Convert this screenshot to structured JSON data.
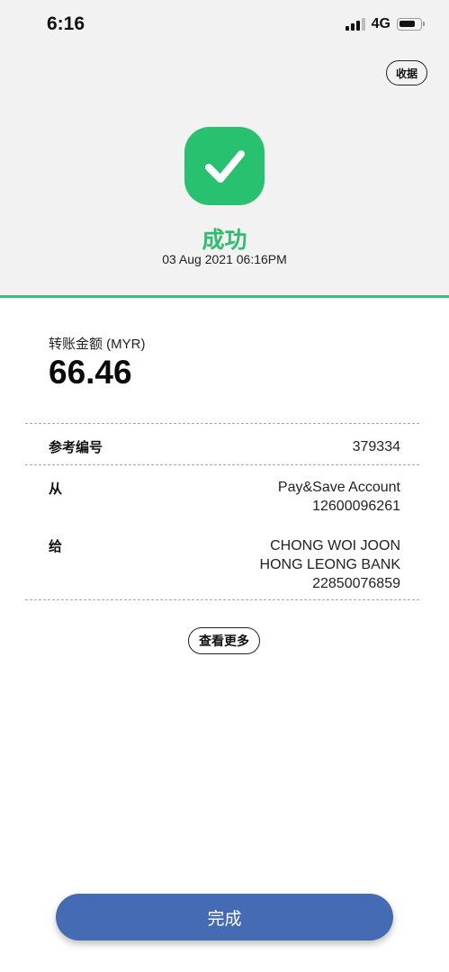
{
  "status_bar": {
    "time": "6:16",
    "network": "4G"
  },
  "header": {
    "receipt_label": "收据",
    "status_title": "成功",
    "datetime": "03 Aug 2021 06:16PM",
    "accent_color": "#27c16f"
  },
  "transfer": {
    "amount_label": "转账金额 (MYR)",
    "amount": "66.46",
    "reference_label": "参考编号",
    "reference_value": "379334",
    "from_label": "从",
    "from_account_name": "Pay&Save Account",
    "from_account_number": "12600096261",
    "to_label": "给",
    "to_name": "CHONG WOI JOON",
    "to_bank": "HONG LEONG BANK",
    "to_account_number": "22850076859"
  },
  "actions": {
    "more_label": "查看更多",
    "done_label": "完成",
    "done_color": "#446bb4"
  }
}
